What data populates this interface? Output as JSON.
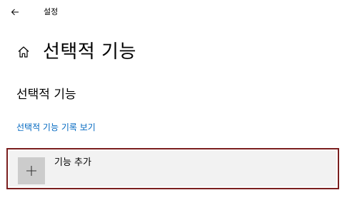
{
  "window": {
    "app_title": "설정",
    "back_icon": "back-arrow-icon"
  },
  "header": {
    "home_icon": "home-icon",
    "title": "선택적 기능"
  },
  "section": {
    "title": "선택적 기능",
    "history_link": "선택적 기능 기록 보기"
  },
  "add_feature": {
    "icon": "plus-icon",
    "label": "기능 추가"
  },
  "colors": {
    "link": "#0067c0",
    "focus_border": "#7a1e1e",
    "tile_background": "#f2f2f2",
    "plus_tile": "#cccccc"
  }
}
